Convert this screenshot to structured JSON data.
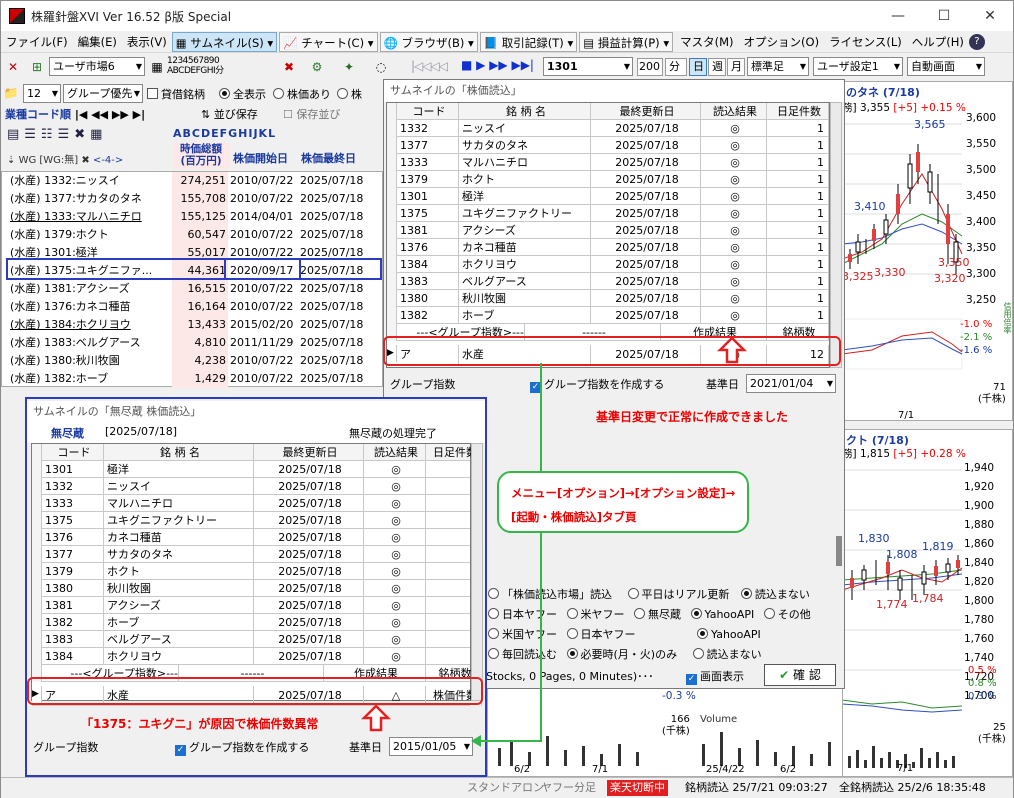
{
  "window": {
    "title": "株羅針盤XVI Ver 16.52 β版  Special",
    "min": "—",
    "max": "☐",
    "close": "✕"
  },
  "menu": {
    "items": [
      "ファイル(F)",
      "編集(E)",
      "表示(V)"
    ],
    "thumb": "サムネイル(S)",
    "chart": "チャート(C)",
    "browser": "ブラウザ(B)",
    "trade": "取引記録(T)",
    "pnl": "損益計算(P)",
    "master": "マスタ(M)",
    "option": "オプション(O)",
    "license": "ライセンス(L)",
    "help": "ヘルプ(H)"
  },
  "toolbar": {
    "market": "ユーザ市場6",
    "code": "1301",
    "period": "200",
    "unit": "分",
    "day": "日",
    "week": "週",
    "month": "月",
    "standard": "標準足",
    "userset": "ユーザ設定1",
    "autoscreen": "自動画面",
    "numpad1": "1234567890",
    "numpad2": "ABCDEFGHI分"
  },
  "left": {
    "groupnum": "12",
    "grouppref": "グループ優先",
    "ck_lend": "貸借銘柄",
    "r_all": "全表示",
    "r_price": "株価あり",
    "r_stock": "株",
    "sortby": "業種コード順",
    "order_save": "並び保存",
    "save_order": "保存並び",
    "letters": "ABCDEFGHIJKL",
    "wg": "WG [WG:無]",
    "range": "<-4->",
    "col_cap": "時価総額\n(百万円)",
    "col_start": "株価開始日",
    "col_end": "株価最終日",
    "rows": [
      {
        "name": "(水産) 1332:ニッスイ",
        "cap": "274,251",
        "start": "2010/07/22",
        "end": "2025/07/18"
      },
      {
        "name": "(水産) 1377:サカタのタネ",
        "cap": "155,708",
        "start": "2010/07/22",
        "end": "2025/07/18"
      },
      {
        "name": "(水産) 1333:マルハニチロ",
        "cap": "155,125",
        "start": "2014/04/01",
        "end": "2025/07/18"
      },
      {
        "name": "(水産) 1379:ホクト",
        "cap": "60,547",
        "start": "2010/07/22",
        "end": "2025/07/18"
      },
      {
        "name": "(水産) 1301:極洋",
        "cap": "55,017",
        "start": "2010/07/22",
        "end": "2025/07/18"
      },
      {
        "name": "(水産) 1375:ユキグニファ...",
        "cap": "44,361",
        "start": "2020/09/17",
        "end": "2025/07/18"
      },
      {
        "name": "(水産) 1381:アクシーズ",
        "cap": "16,515",
        "start": "2010/07/22",
        "end": "2025/07/18"
      },
      {
        "name": "(水産) 1376:カネコ種苗",
        "cap": "16,164",
        "start": "2010/07/22",
        "end": "2025/07/18"
      },
      {
        "name": "(水産) 1384:ホクリヨウ",
        "cap": "13,433",
        "start": "2015/02/20",
        "end": "2025/07/18"
      },
      {
        "name": "(水産) 1383:ベルグアース",
        "cap": "4,810",
        "start": "2011/11/29",
        "end": "2025/07/18"
      },
      {
        "name": "(水産) 1380:秋川牧園",
        "cap": "4,238",
        "start": "2010/07/22",
        "end": "2025/07/18"
      },
      {
        "name": "(水産) 1382:ホーブ",
        "cap": "1,429",
        "start": "2010/07/22",
        "end": "2025/07/18"
      }
    ]
  },
  "top_dialog": {
    "title": "サムネイルの「株価読込」",
    "headers": [
      "コード",
      "銘 柄 名",
      "最終更新日",
      "読込結果",
      "日足件数"
    ],
    "rows": [
      [
        "1332",
        "ニッスイ",
        "2025/07/18",
        "◎",
        "1"
      ],
      [
        "1377",
        "サカタのタネ",
        "2025/07/18",
        "◎",
        "1"
      ],
      [
        "1333",
        "マルハニチロ",
        "2025/07/18",
        "◎",
        "1"
      ],
      [
        "1379",
        "ホクト",
        "2025/07/18",
        "◎",
        "1"
      ],
      [
        "1301",
        "極洋",
        "2025/07/18",
        "◎",
        "1"
      ],
      [
        "1375",
        "ユキグニファクトリー",
        "2025/07/18",
        "◎",
        "1"
      ],
      [
        "1381",
        "アクシーズ",
        "2025/07/18",
        "◎",
        "1"
      ],
      [
        "1376",
        "カネコ種苗",
        "2025/07/18",
        "◎",
        "1"
      ],
      [
        "1384",
        "ホクリヨウ",
        "2025/07/18",
        "◎",
        "1"
      ],
      [
        "1383",
        "ベルグアース",
        "2025/07/18",
        "◎",
        "1"
      ],
      [
        "1380",
        "秋川牧園",
        "2025/07/18",
        "◎",
        "1"
      ],
      [
        "1382",
        "ホーブ",
        "2025/07/18",
        "◎",
        "1"
      ]
    ],
    "group_row": [
      "---<グループ指数>---",
      "------",
      "作成結果",
      "銘柄数"
    ],
    "final_row": [
      "ア",
      "水産",
      "2025/07/18",
      "◎",
      "12"
    ],
    "group_label": "グループ指数",
    "group_check": "グループ指数を作成する",
    "base_label": "基準日",
    "base_date": "2021/01/04",
    "annot": "基準日変更で正常に作成できました"
  },
  "bottom_dialog": {
    "title": "サムネイルの「無尽蔵 株価読込」",
    "src": "無尽蔵",
    "date": "[2025/07/18]",
    "status": "無尽蔵の処理完了",
    "headers": [
      "コード",
      "銘 柄 名",
      "最終更新日",
      "読込結果",
      "日足件数"
    ],
    "rows": [
      [
        "1301",
        "極洋",
        "2025/07/18",
        "◎",
        "1"
      ],
      [
        "1332",
        "ニッスイ",
        "2025/07/18",
        "◎",
        "1"
      ],
      [
        "1333",
        "マルハニチロ",
        "2025/07/18",
        "◎",
        "1"
      ],
      [
        "1375",
        "ユキグニファクトリー",
        "2025/07/18",
        "◎",
        "1"
      ],
      [
        "1376",
        "カネコ種苗",
        "2025/07/18",
        "◎",
        "1"
      ],
      [
        "1377",
        "サカタのタネ",
        "2025/07/18",
        "◎",
        "1"
      ],
      [
        "1379",
        "ホクト",
        "2025/07/18",
        "◎",
        "1"
      ],
      [
        "1380",
        "秋川牧園",
        "2025/07/18",
        "◎",
        "1"
      ],
      [
        "1381",
        "アクシーズ",
        "2025/07/18",
        "◎",
        "1"
      ],
      [
        "1382",
        "ホーブ",
        "2025/07/18",
        "◎",
        "1"
      ],
      [
        "1383",
        "ベルグアース",
        "2025/07/18",
        "◎",
        "1"
      ],
      [
        "1384",
        "ホクリヨウ",
        "2025/07/18",
        "◎",
        "1"
      ]
    ],
    "group_row": [
      "---<グループ指数>---",
      "------",
      "作成結果",
      "銘柄数"
    ],
    "final_row": [
      "ア",
      "水産",
      "2025/07/18",
      "△",
      "株価件数"
    ],
    "group_label": "グループ指数",
    "group_check": "グループ指数を作成する",
    "base_label": "基準日",
    "base_date": "2015/01/05",
    "annot": "「1375：ユキグニ」が原因で株価件数異常"
  },
  "callout": {
    "line1": "メニュー[オプション]→[オプション設定]→",
    "line2": "[起動・株価読込]タブ頁"
  },
  "options": {
    "r1": [
      "「株価読込市場」読込",
      "平日はリアル更新",
      "読込まない"
    ],
    "r2": [
      "日本ヤフー",
      "米ヤフー",
      "無尽蔵",
      "YahooAPI",
      "その他"
    ],
    "r3": [
      "米国ヤフー",
      "日本ヤフー",
      "YahooAPI"
    ],
    "r4": [
      "毎回読込む",
      "必要時(月・火)のみ",
      "読込まない"
    ],
    "stats": "Stocks, 0 Pages, 0 Minutes)･･･",
    "screen": "画面表示",
    "ok": "確 認"
  },
  "chart_top": {
    "title": "のタネ (7/18)",
    "price": "3,355",
    "change": "[+5] +0.15 %",
    "lbl": "務]",
    "y": [
      "3,600",
      "3,550",
      "3,500",
      "3,450",
      "3,400",
      "3,350",
      "3,300",
      "3,250"
    ],
    "ann": [
      "3,565",
      "3,410",
      "3,330",
      "3,325",
      "3,350",
      "3,320"
    ],
    "pct": [
      "-1.0 %",
      "-2.1 %",
      "-1.6 %"
    ],
    "vol": "71",
    "volunit": "(千株)",
    "date": "7/1"
  },
  "chart_bot": {
    "title": "クト (7/18)",
    "price": "1,815",
    "change": "[+5] +0.28 %",
    "lbl": "務]",
    "y": [
      "1,940",
      "1,920",
      "1,900",
      "1,880",
      "1,860",
      "1,840",
      "1,820",
      "1,800",
      "1,780",
      "1,760",
      "1,740",
      "1,720",
      "1,700"
    ],
    "ann": [
      "1,830",
      "1,808",
      "1,819",
      "1,774",
      "1,784"
    ],
    "pct": [
      "0.5 %",
      "0.8 %",
      "0.3 %",
      "-0.3 %"
    ],
    "vol": "166",
    "volunit": "(千株)",
    "vol2": "25",
    "volunit2": "(千株)",
    "volume": "Volume",
    "dates": [
      "6/2",
      "7/1",
      "25/4/22",
      "6/2",
      "7/1"
    ]
  },
  "status": {
    "standalone": "スタンドアロン",
    "yahoo": "ヤフー分足",
    "rakuten": "楽天切断中",
    "read": "銘柄読込  25/7/21 09:03:27",
    "all": "全銘柄読込 25/2/6 18:35:48"
  }
}
